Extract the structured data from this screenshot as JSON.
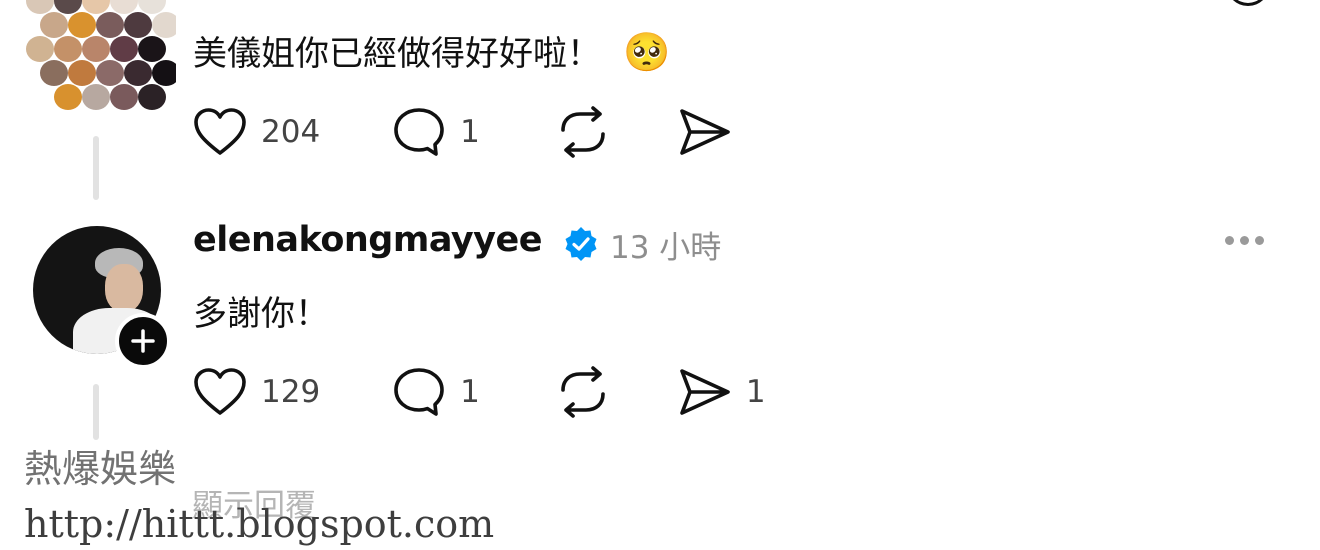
{
  "reply1": {
    "text": "美儀姐你已經做得好好啦！",
    "emoji": "🥺",
    "likes": "204",
    "comments": "1"
  },
  "reply2": {
    "username": "elenakongmayyee",
    "time": "13 小時",
    "text": "多謝你！",
    "likes": "129",
    "comments": "1",
    "shares": "1"
  },
  "show_replies": "顯示回覆",
  "watermark": {
    "title": "熱爆娛樂",
    "url": "http://hittt.blogspot.com"
  },
  "colors": {
    "verified": "#0095f6",
    "text": "#111111",
    "muted": "#8e8e8e"
  }
}
